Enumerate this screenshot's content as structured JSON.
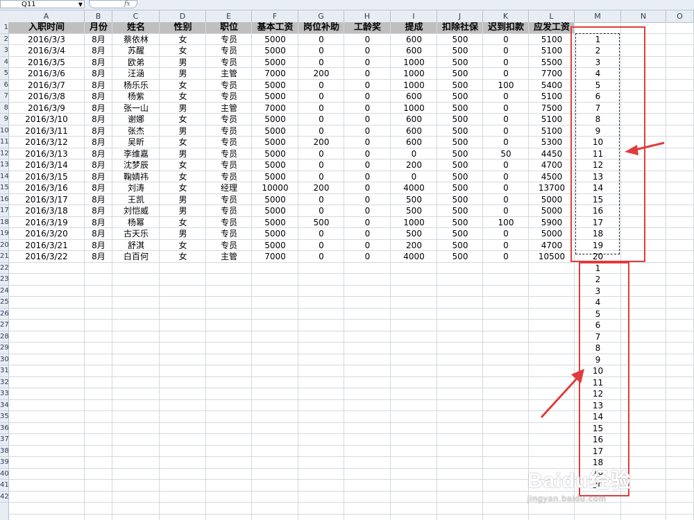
{
  "formula_bar": {
    "name_box": "Q11",
    "fx": "fx"
  },
  "columns": [
    "A",
    "B",
    "C",
    "D",
    "E",
    "F",
    "G",
    "H",
    "I",
    "J",
    "K",
    "L",
    "M",
    "N",
    "O"
  ],
  "row_numbers": [
    "1",
    "2",
    "3",
    "4",
    "5",
    "6",
    "7",
    "8",
    "9",
    "10",
    "11",
    "12",
    "13",
    "14",
    "15",
    "16",
    "17",
    "18",
    "19",
    "20",
    "21",
    "22",
    "23",
    "24",
    "25",
    "26",
    "27",
    "28",
    "29",
    "30",
    "31",
    "32",
    "33",
    "34",
    "35",
    "36",
    "37",
    "38",
    "39",
    "40",
    "41",
    "42"
  ],
  "headers": [
    "入职时间",
    "月份",
    "姓名",
    "性别",
    "职位",
    "基本工资",
    "岗位补助",
    "工龄奖",
    "提成",
    "扣除社保",
    "迟到扣款",
    "应发工资"
  ],
  "rows": [
    [
      "2016/3/3",
      "8月",
      "蔡依林",
      "女",
      "专员",
      "5000",
      "0",
      "0",
      "600",
      "500",
      "0",
      "5100",
      "1"
    ],
    [
      "2016/3/4",
      "8月",
      "苏醒",
      "女",
      "专员",
      "5000",
      "0",
      "0",
      "600",
      "500",
      "0",
      "5100",
      "2"
    ],
    [
      "2016/3/5",
      "8月",
      "欧弟",
      "男",
      "专员",
      "5000",
      "0",
      "0",
      "1000",
      "500",
      "0",
      "5500",
      "3"
    ],
    [
      "2016/3/6",
      "8月",
      "汪涵",
      "男",
      "主管",
      "7000",
      "200",
      "0",
      "1000",
      "500",
      "0",
      "7700",
      "4"
    ],
    [
      "2016/3/7",
      "8月",
      "杨乐乐",
      "女",
      "专员",
      "5000",
      "0",
      "0",
      "1000",
      "500",
      "100",
      "5400",
      "5"
    ],
    [
      "2016/3/8",
      "8月",
      "杨紫",
      "女",
      "专员",
      "5000",
      "0",
      "0",
      "600",
      "500",
      "0",
      "5100",
      "6"
    ],
    [
      "2016/3/9",
      "8月",
      "张一山",
      "男",
      "主管",
      "7000",
      "0",
      "0",
      "1000",
      "500",
      "0",
      "7500",
      "7"
    ],
    [
      "2016/3/10",
      "8月",
      "谢娜",
      "女",
      "专员",
      "5000",
      "0",
      "0",
      "600",
      "500",
      "0",
      "5100",
      "8"
    ],
    [
      "2016/3/11",
      "8月",
      "张杰",
      "男",
      "专员",
      "5000",
      "0",
      "0",
      "600",
      "500",
      "0",
      "5100",
      "9"
    ],
    [
      "2016/3/12",
      "8月",
      "吴昕",
      "女",
      "专员",
      "5000",
      "200",
      "0",
      "600",
      "500",
      "0",
      "5300",
      "10"
    ],
    [
      "2016/3/13",
      "8月",
      "李维嘉",
      "男",
      "专员",
      "5000",
      "0",
      "0",
      "0",
      "500",
      "50",
      "4450",
      "11"
    ],
    [
      "2016/3/14",
      "8月",
      "沈梦辰",
      "女",
      "专员",
      "5000",
      "0",
      "0",
      "200",
      "500",
      "0",
      "4700",
      "12"
    ],
    [
      "2016/3/15",
      "8月",
      "鞠婧祎",
      "女",
      "专员",
      "5000",
      "0",
      "0",
      "0",
      "500",
      "0",
      "4500",
      "13"
    ],
    [
      "2016/3/16",
      "8月",
      "刘涛",
      "女",
      "经理",
      "10000",
      "200",
      "0",
      "4000",
      "500",
      "0",
      "13700",
      "14"
    ],
    [
      "2016/3/17",
      "8月",
      "王凯",
      "男",
      "专员",
      "5000",
      "0",
      "0",
      "500",
      "500",
      "0",
      "5000",
      "15"
    ],
    [
      "2016/3/18",
      "8月",
      "刘恺威",
      "男",
      "专员",
      "5000",
      "0",
      "0",
      "500",
      "500",
      "0",
      "5000",
      "16"
    ],
    [
      "2016/3/19",
      "8月",
      "杨幂",
      "女",
      "专员",
      "5000",
      "500",
      "0",
      "1000",
      "500",
      "100",
      "5900",
      "17"
    ],
    [
      "2016/3/20",
      "8月",
      "古天乐",
      "男",
      "专员",
      "5000",
      "0",
      "0",
      "500",
      "500",
      "0",
      "5000",
      "18"
    ],
    [
      "2016/3/21",
      "8月",
      "舒淇",
      "女",
      "专员",
      "5000",
      "0",
      "0",
      "200",
      "500",
      "0",
      "4700",
      "19"
    ],
    [
      "2016/3/22",
      "8月",
      "白百何",
      "女",
      "主管",
      "7000",
      "0",
      "0",
      "4000",
      "500",
      "0",
      "10500",
      "20"
    ]
  ],
  "pasted_numbers": [
    "1",
    "2",
    "3",
    "4",
    "5",
    "6",
    "7",
    "8",
    "9",
    "10",
    "11",
    "12",
    "13",
    "14",
    "15",
    "16",
    "17",
    "18",
    "19",
    "20"
  ],
  "watermark": {
    "brand": "Baidu经验",
    "url": "jingyan.baidu.com"
  },
  "annotation_color": "#e03c3c"
}
